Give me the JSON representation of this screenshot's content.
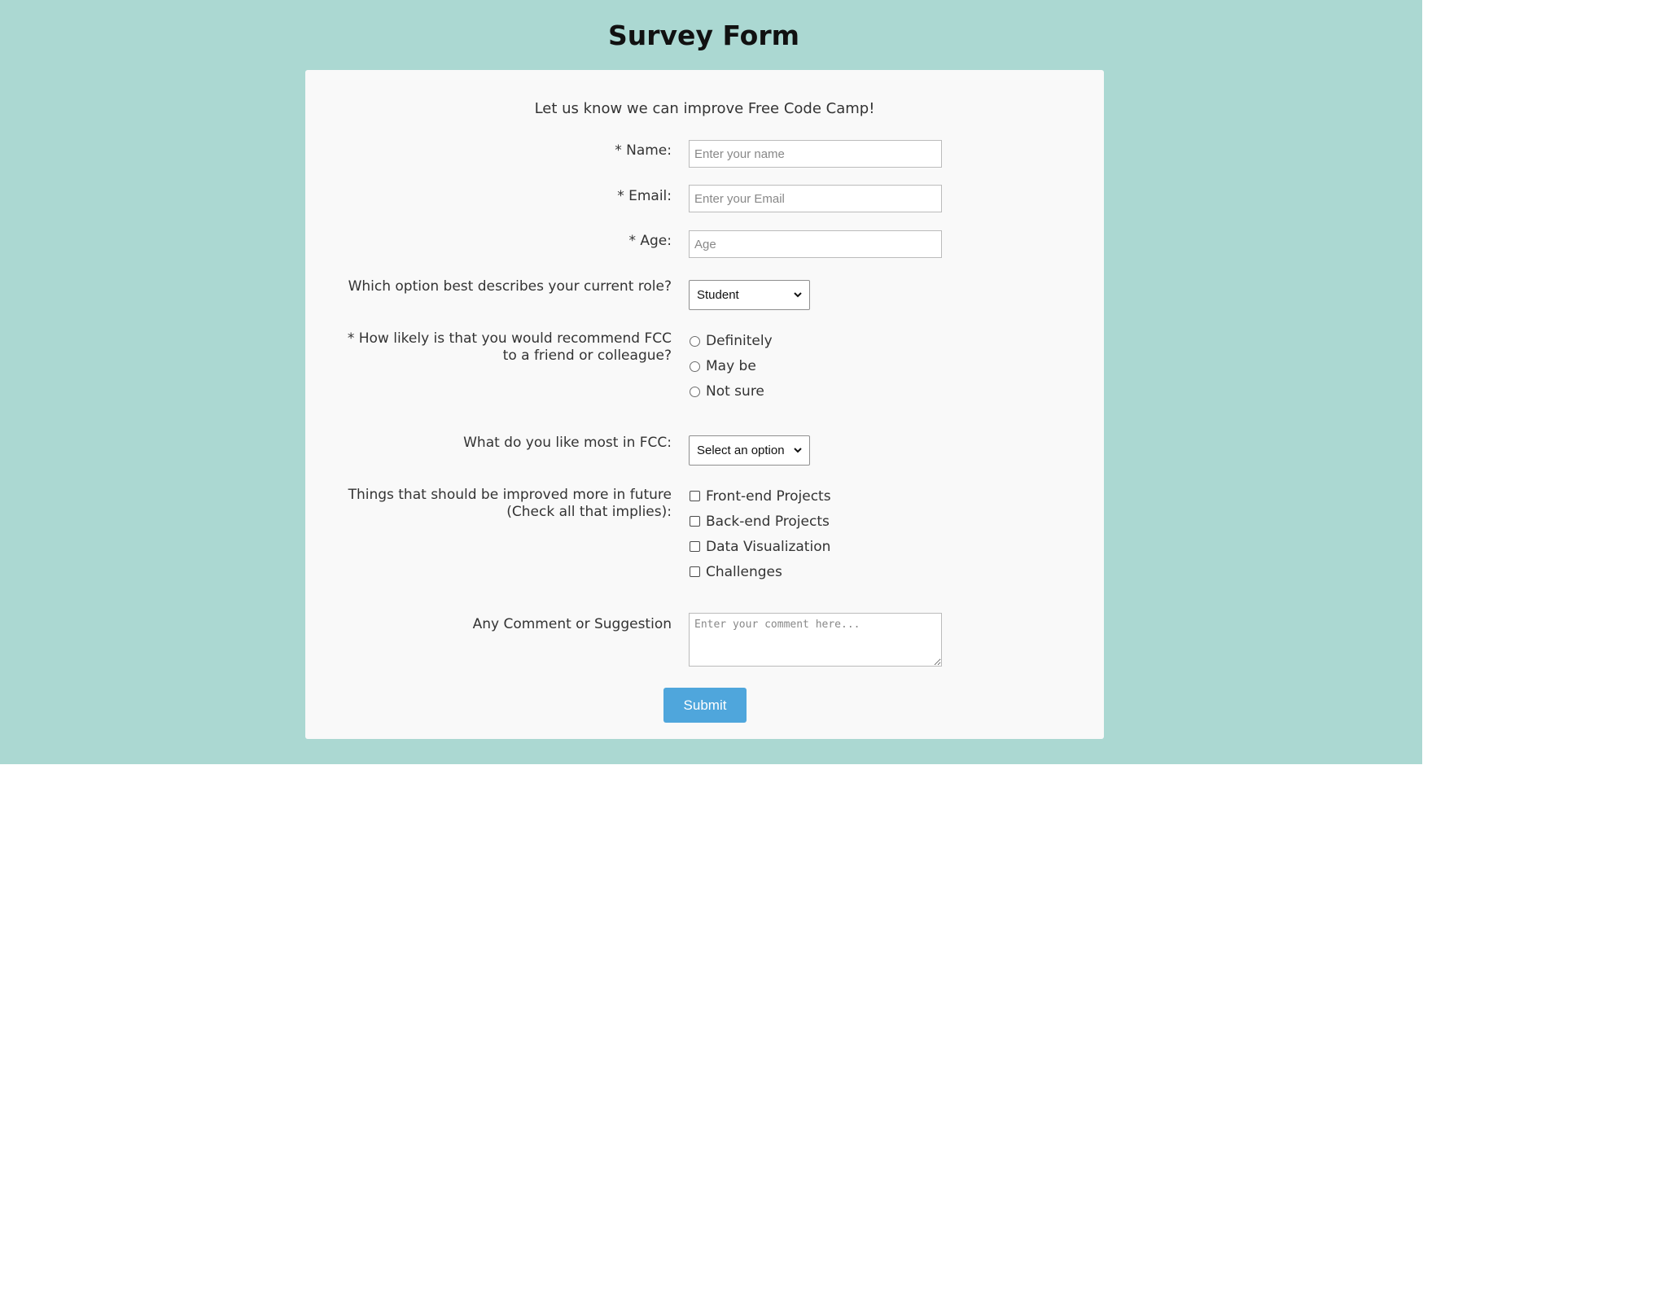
{
  "page": {
    "title": "Survey Form",
    "background_color": "#abd8d2",
    "card_color": "#f9f9f9",
    "accent_color": "#4fa6dc"
  },
  "form": {
    "subtitle": "Let us know we can improve Free Code Camp!",
    "name": {
      "label": "* Name:",
      "placeholder": "Enter your name",
      "value": ""
    },
    "email": {
      "label": "* Email:",
      "placeholder": "Enter your Email",
      "value": ""
    },
    "age": {
      "label": "* Age:",
      "placeholder": "Age",
      "value": ""
    },
    "role": {
      "label": "Which option best describes your current role?",
      "selected": "Student",
      "icon": "chevron-down-icon"
    },
    "recommend": {
      "label_line1": "* How likely is that you would recommend FCC",
      "label_line2": "to a friend or colleague?",
      "options": [
        "Definitely",
        "May be",
        "Not sure"
      ]
    },
    "like_most": {
      "label": "What do you like most in FCC:",
      "selected": "Select an option",
      "icon": "chevron-down-icon"
    },
    "improve": {
      "label_line1": "Things that should be improved more in future",
      "label_line2": "(Check all that implies):",
      "options": [
        "Front-end Projects",
        "Back-end Projects",
        "Data Visualization",
        "Challenges"
      ]
    },
    "comment": {
      "label": "Any Comment or Suggestion",
      "placeholder": "Enter your comment here..."
    },
    "submit_label": "Submit"
  }
}
